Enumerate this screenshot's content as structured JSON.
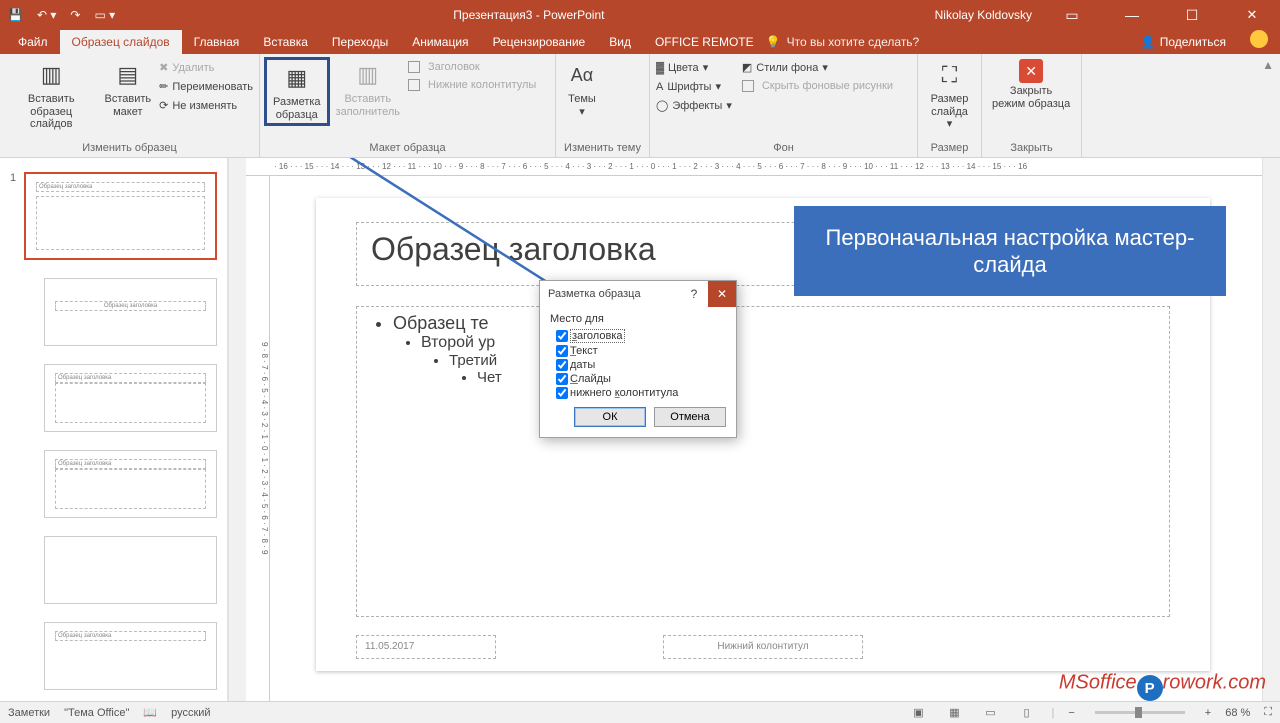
{
  "titlebar": {
    "doc_title": "Презентация3 - PowerPoint",
    "user": "Nikolay Koldovsky"
  },
  "tabs": {
    "file": "Файл",
    "active": "Образец слайдов",
    "others": [
      "Главная",
      "Вставка",
      "Переходы",
      "Анимация",
      "Рецензирование",
      "Вид",
      "OFFICE REMOTE"
    ],
    "tell_me": "Что вы хотите сделать?",
    "share": "Поделиться"
  },
  "ribbon": {
    "insert_master": "Вставить\nобразец слайдов",
    "insert_layout": "Вставить\nмакет",
    "delete": "Удалить",
    "rename": "Переименовать",
    "preserve": "Не изменять",
    "g1": "Изменить образец",
    "master_layout": "Разметка\nобразца",
    "insert_ph": "Вставить\nзаполнитель",
    "cb_title": "Заголовок",
    "cb_footers": "Нижние колонтитулы",
    "g2": "Макет образца",
    "themes": "Темы",
    "g3": "Изменить тему",
    "colors": "Цвета",
    "fonts": "Шрифты",
    "effects": "Эффекты",
    "bgstyles": "Стили фона",
    "hide_bg": "Скрыть фоновые рисунки",
    "g4": "Фон",
    "slide_size": "Размер\nслайда",
    "g5": "Размер",
    "close_master": "Закрыть\nрежим образца",
    "g6": "Закрыть"
  },
  "slide": {
    "title_ph": "Образец заголовка",
    "body_l1": "Образец те",
    "body_l2": "Второй ур",
    "body_l3": "Третий",
    "body_l4": "Чет",
    "date": "11.05.2017",
    "footer": "Нижний колонтитул"
  },
  "thumbs": {
    "mini_title": "Образец заголовка"
  },
  "callout": "Первоначальная настройка мастер-слайда",
  "dialog": {
    "title": "Разметка образца",
    "section": "Место для",
    "opts": [
      "заголовка",
      "Текст",
      "даты",
      "Слайды",
      "нижнего колонтитула"
    ],
    "opt_underline": [
      "з",
      "Т",
      "д",
      "С",
      "к"
    ],
    "ok": "ОК",
    "cancel": "Отмена"
  },
  "ruler_h": "· 16 · · · 15 · · · 14 · · · 13 · · · 12 · · · 11 · · · 10 · · · 9 · · · 8 · · · 7 · · · 6 · · · 5 · · · 4 · · · 3 · · · 2 · · · 1 · · · 0 · · · 1 · · · 2 · · · 3 · · · 4 · · · 5 · · · 6 · · · 7 · · · 8 · · · 9 · · · 10 · · · 11 · · · 12 · · · 13 · · · 14 · · · 15 · · · 16",
  "ruler_v": "9 · 8 · 7 · 6 · 5 · 4 · 3 · 2 · 1 · 0 · 1 · 2 · 3 · 4 · 5 · 6 · 7 · 8 · 9",
  "status": {
    "notes": "Заметки",
    "theme": "\"Тема Office\"",
    "lang": "русский",
    "zoom": "68 %"
  },
  "watermark": {
    "a": "MSoffice",
    "b": "rowork.com"
  }
}
